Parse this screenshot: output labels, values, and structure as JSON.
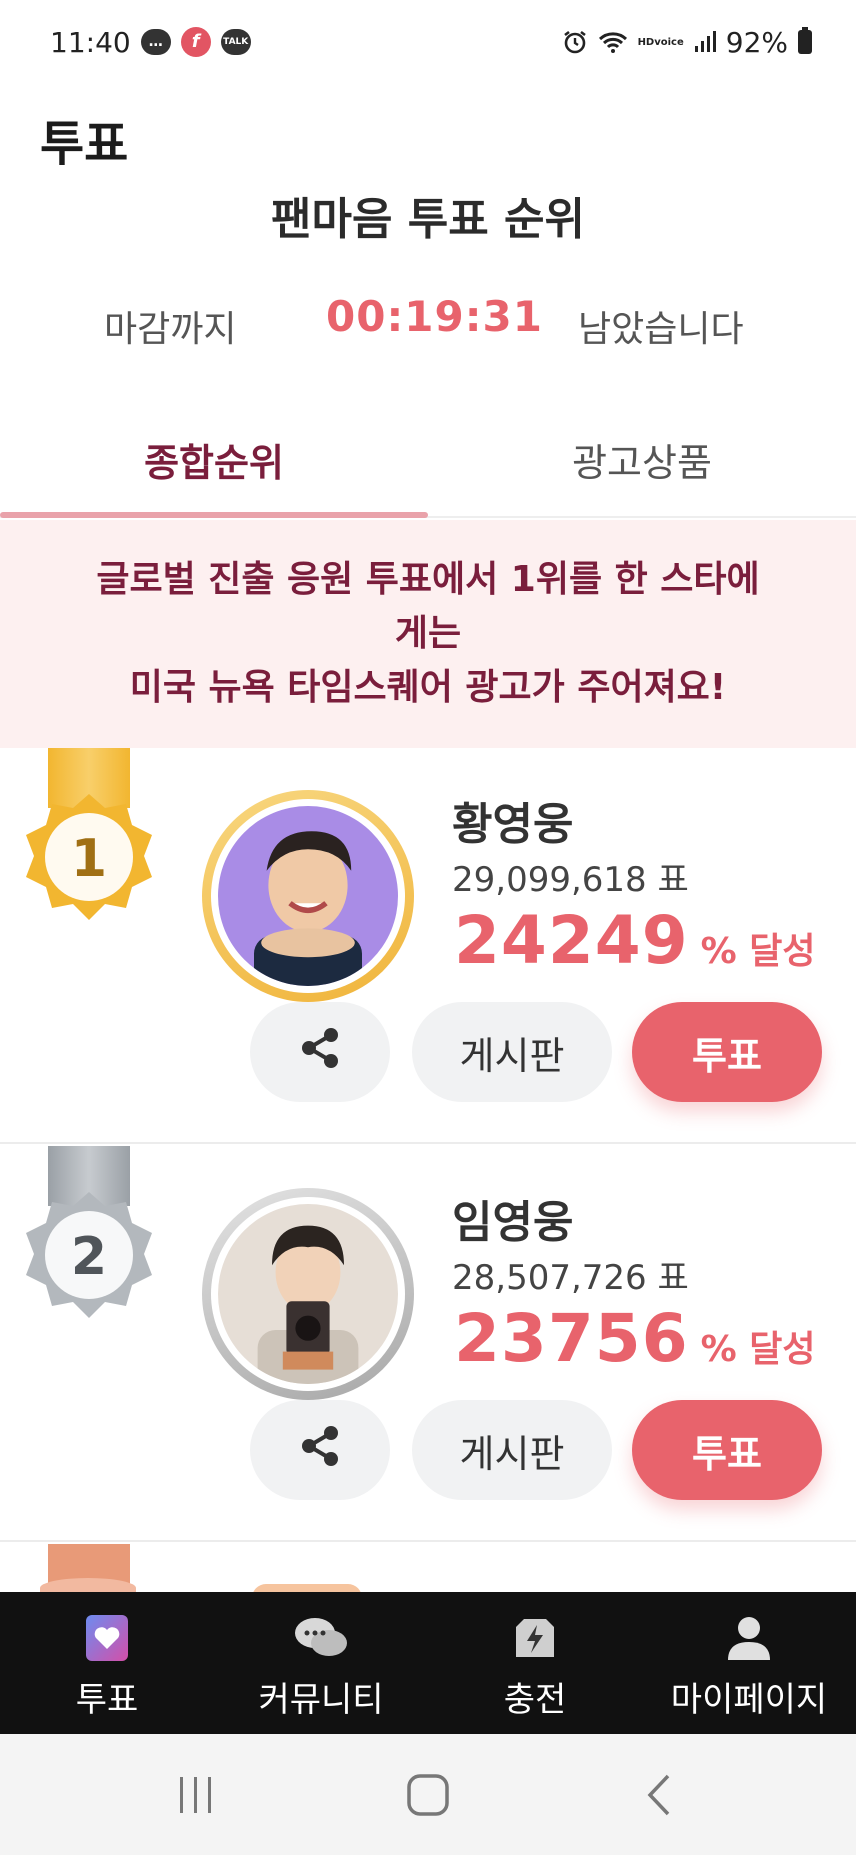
{
  "status_bar": {
    "time": "11:40",
    "battery": "92%",
    "hd_voice_top": "HD",
    "hd_voice_bottom": "voice",
    "talk_label": "TALK",
    "f_label": "f"
  },
  "header": {
    "title": "투표",
    "section_title": "팬마음 투표 순위"
  },
  "deadline": {
    "prefix": "마감까지",
    "timer": "00:19:31",
    "suffix": "남았습니다"
  },
  "tabs": [
    {
      "label": "종합순위",
      "active": true
    },
    {
      "label": "광고상품",
      "active": false
    }
  ],
  "banner": {
    "line1": "글로벌 진출 응원 투표에서 1위를 한 스타에",
    "line2": "게는",
    "line3": "미국 뉴욕 타임스퀘어 광고가 주어져요!"
  },
  "ranking": [
    {
      "rank": "1",
      "name": "황영웅",
      "votes": "29,099,618 표",
      "percent": "24249",
      "percent_unit": "% 달성",
      "board_label": "게시판",
      "vote_label": "투표",
      "medal_color": "#f2b630"
    },
    {
      "rank": "2",
      "name": "임영웅",
      "votes": "28,507,726 표",
      "percent": "23756",
      "percent_unit": "% 달성",
      "board_label": "게시판",
      "vote_label": "투표",
      "medal_color": "#a9adb2"
    }
  ],
  "bottom_nav": [
    {
      "label": "투표",
      "icon": "heart-card-icon"
    },
    {
      "label": "커뮤니티",
      "icon": "chat-bubbles-icon"
    },
    {
      "label": "충전",
      "icon": "lightning-shop-icon"
    },
    {
      "label": "마이페이지",
      "icon": "user-icon"
    }
  ],
  "colors": {
    "accent": "#e8636c",
    "deep": "#7a1e3c",
    "banner_bg": "#fdf0f0",
    "nav_bg": "#111111"
  }
}
